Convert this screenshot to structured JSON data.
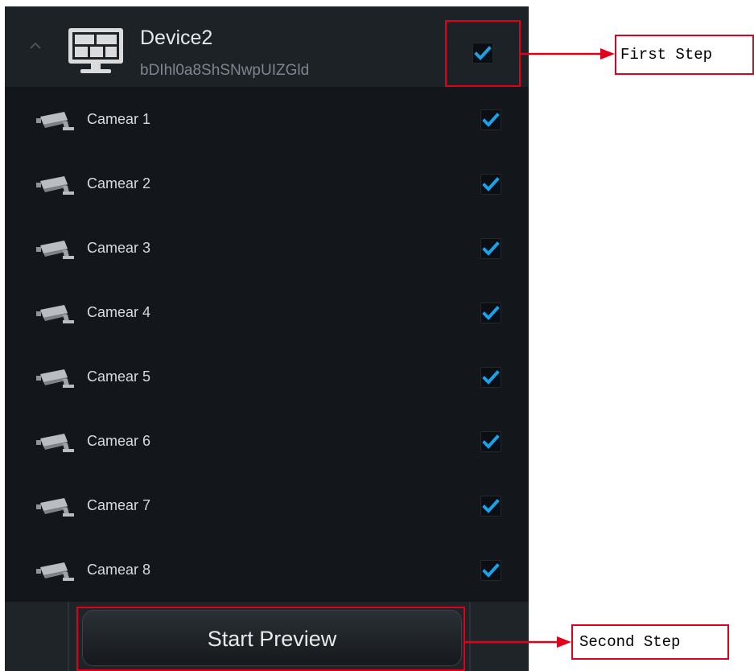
{
  "device": {
    "name": "Device2",
    "id": "bDIhl0a8ShSNwpUIZGld",
    "checked": true
  },
  "cameras": [
    {
      "label": "Camear 1",
      "checked": true
    },
    {
      "label": "Camear 2",
      "checked": true
    },
    {
      "label": "Camear 3",
      "checked": true
    },
    {
      "label": "Camear 4",
      "checked": true
    },
    {
      "label": "Camear 5",
      "checked": true
    },
    {
      "label": "Camear 6",
      "checked": true
    },
    {
      "label": "Camear 7",
      "checked": true
    },
    {
      "label": "Camear 8",
      "checked": true
    }
  ],
  "footer": {
    "start_preview_label": "Start Preview"
  },
  "annotations": {
    "first_step_label": "First Step",
    "second_step_label": "Second Step"
  },
  "icons": {
    "collapse": "chevron-up-icon",
    "device": "monitor-icon",
    "camera": "cctv-camera-icon",
    "checkbox": "checkmark-icon"
  },
  "colors": {
    "check_accent": "#1aa1e6",
    "annotation_red": "#e0001b",
    "panel_background": "#13171b"
  }
}
